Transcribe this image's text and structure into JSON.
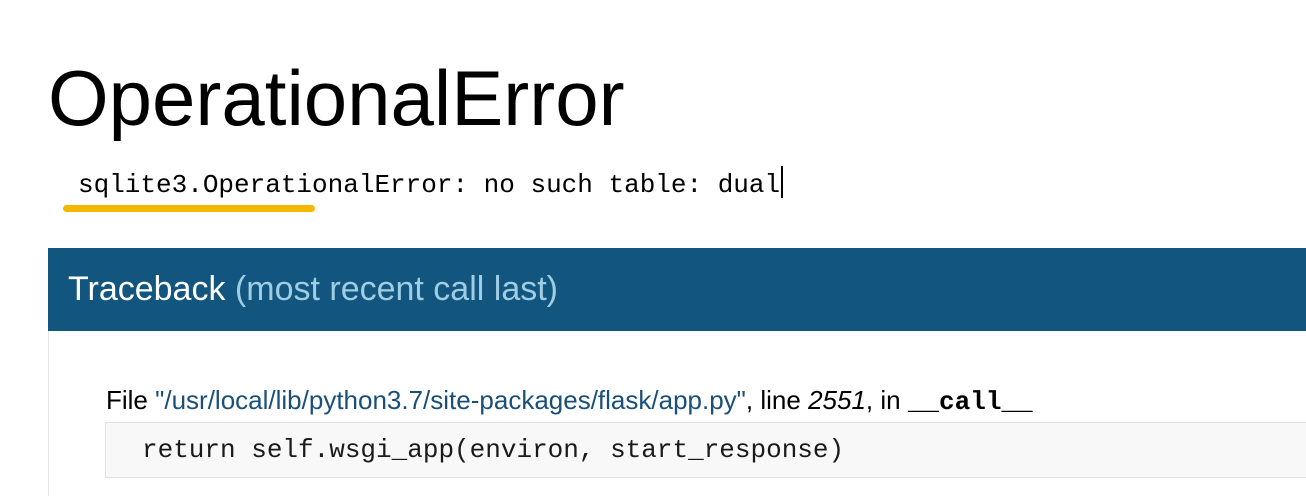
{
  "error": {
    "title": "OperationalError",
    "message": "sqlite3.OperationalError: no such table: dual"
  },
  "traceback": {
    "heading": "Traceback",
    "subheading": "(most recent call last)",
    "frames": [
      {
        "file_prefix": "File ",
        "path": "\"/usr/local/lib/python3.7/site-packages/flask/app.py\"",
        "line_prefix": ", line ",
        "line": "2551",
        "func_prefix": ", in ",
        "function": "__call__",
        "source": "return self.wsgi_app(environ, start_response)"
      }
    ]
  },
  "colors": {
    "header_background": "#12557f",
    "highlight": "#f5b800",
    "path_text": "#1a4f78"
  }
}
